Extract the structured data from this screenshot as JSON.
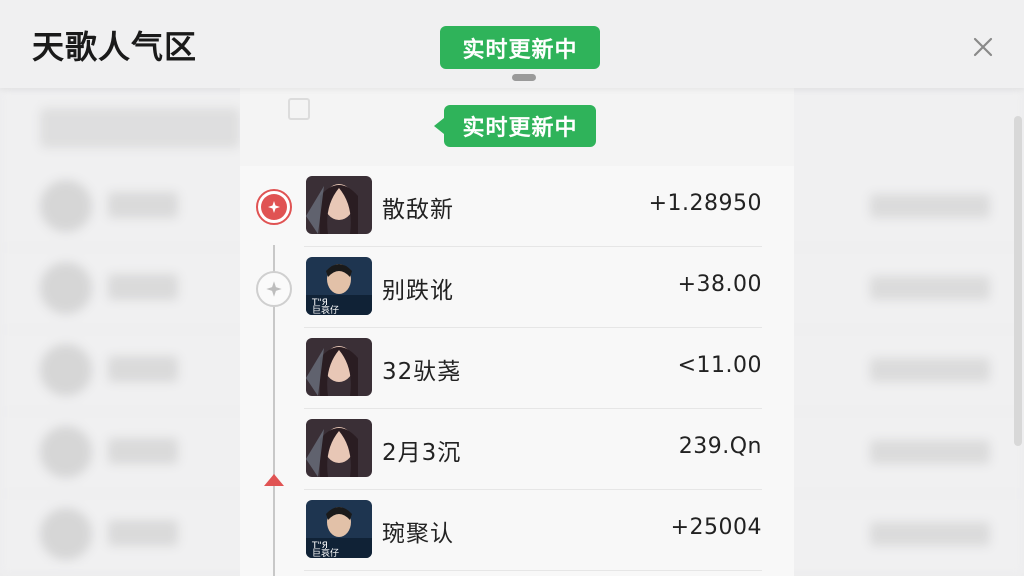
{
  "header": {
    "title": "天歌人气区",
    "badge_label": "实时更新中"
  },
  "panel": {
    "badge_label": "实时更新中"
  },
  "list": [
    {
      "name": "散敌新",
      "value": "+1.28950",
      "avatar": "female-avatar"
    },
    {
      "name": "别跌讹",
      "value": "+38.00",
      "avatar": "male-avatar"
    },
    {
      "name": "32驮荛",
      "value": "<11.00",
      "avatar": "female-avatar"
    },
    {
      "name": "2月3沉",
      "value": "239.Qn",
      "avatar": "female-avatar"
    },
    {
      "name": "琬聚认",
      "value": "+25004",
      "avatar": "male-avatar"
    }
  ],
  "colors": {
    "accent_green": "#2fb35a",
    "accent_red": "#e05353",
    "background": "#ededee"
  },
  "icons": {
    "close": "close-icon",
    "active_marker": "plus-circle-icon",
    "inactive_marker": "plus-circle-icon",
    "timeline_arrow": "triangle-up-icon"
  }
}
